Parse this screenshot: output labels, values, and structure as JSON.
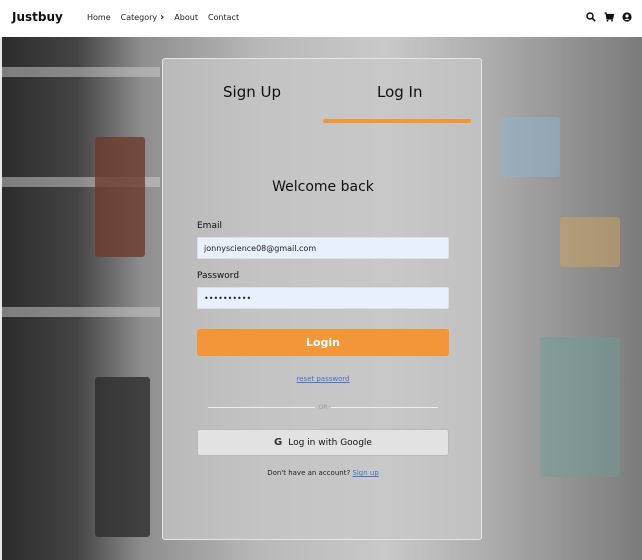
{
  "navbar": {
    "brand": "Justbuy",
    "links": {
      "home": "Home",
      "category": "Category",
      "about": "About",
      "contact": "Contact"
    },
    "icons": [
      "search-icon",
      "cart-icon",
      "user-icon"
    ]
  },
  "auth": {
    "tabs": {
      "signup": "Sign Up",
      "login": "Log In"
    },
    "active_tab": "login",
    "heading": "Welcome back",
    "email_label": "Email",
    "email_value": "jonnyscience08@gmail.com",
    "password_label": "Password",
    "password_value": "••••••••••",
    "login_button": "Login",
    "reset_link": "reset password",
    "divider_text": "OR",
    "google_button": "Log in with Google",
    "no_account_text": "Don't have an account?",
    "signup_link": "Sign up",
    "accent_color": "#f3963a"
  }
}
